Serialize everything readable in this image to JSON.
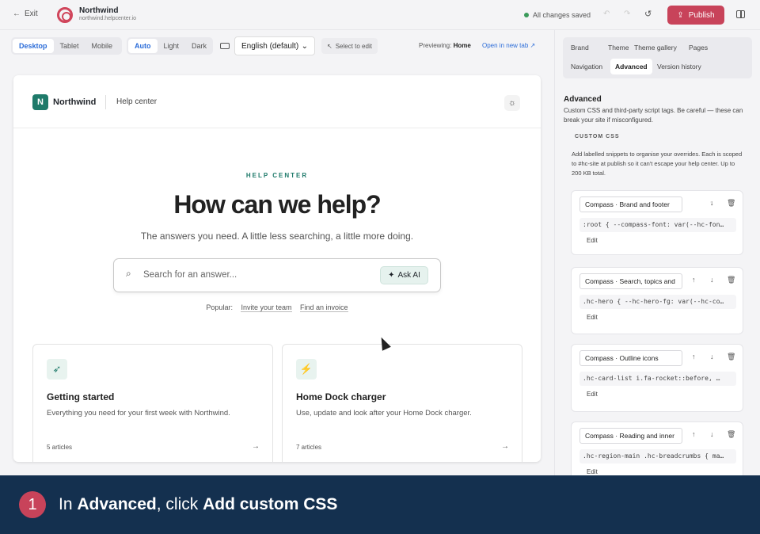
{
  "topbar": {
    "exit_label": "Exit",
    "site_name": "Northwind",
    "site_url": "northwind.helpcenter.io",
    "save_status": "All changes saved",
    "publish_label": "Publish"
  },
  "toolbar": {
    "devices": [
      "Desktop",
      "Tablet",
      "Mobile"
    ],
    "active_device": "Desktop",
    "themes": [
      "Auto",
      "Light",
      "Dark"
    ],
    "active_theme": "Auto",
    "language": "English (default)",
    "select_to_edit": "Select to edit",
    "previewing_label": "Previewing:",
    "previewing_page": "Home",
    "open_new_tab": "Open in new tab"
  },
  "site": {
    "logo_letter": "N",
    "name": "Northwind",
    "section": "Help center",
    "eyebrow": "HELP CENTER",
    "hero": "How can we help?",
    "subtitle": "The answers you need. A little less searching, a little more doing.",
    "search_placeholder": "Search for an answer...",
    "ask_ai": "Ask AI",
    "popular_label": "Popular:",
    "popular_links": [
      "Invite your team",
      "Find an invoice"
    ],
    "cards": [
      {
        "title": "Getting started",
        "desc": "Everything you need for your first week with Northwind.",
        "count": "5 articles",
        "icon": "rocket-icon"
      },
      {
        "title": "Home Dock charger",
        "desc": "Use, update and look after your Home Dock charger.",
        "count": "7 articles",
        "icon": "charger-icon"
      }
    ]
  },
  "panel": {
    "tabs_row1": [
      "Brand",
      "Theme",
      "Theme gallery",
      "Pages"
    ],
    "tabs_row2": [
      "Navigation",
      "Advanced",
      "Version history"
    ],
    "active_tab": "Advanced",
    "title": "Advanced",
    "desc": "Custom CSS and third-party script tags. Be careful — these can break your site if misconfigured.",
    "section_label": "CUSTOM CSS",
    "section_desc": "Add labelled snippets to organise your overrides. Each is scoped to #hc-site at publish so it can't escape your help center. Up to 200 KB total.",
    "edit_label": "Edit",
    "snippets": [
      {
        "name": "Compass · Brand and footer",
        "code": ":root { --compass-font: var(--hc-fon…"
      },
      {
        "name": "Compass · Search, topics and",
        "code": ".hc-hero { --hc-hero-fg: var(--hc-co…"
      },
      {
        "name": "Compass · Outline icons",
        "code": ".hc-card-list i.fa-rocket::before, …"
      },
      {
        "name": "Compass · Reading and inner",
        "code": ".hc-region-main .hc-breadcrumbs { ma…"
      }
    ]
  },
  "caption": {
    "step": "1",
    "text_pre": "In ",
    "text_b1": "Advanced",
    "text_mid": ", click ",
    "text_b2": "Add custom CSS"
  },
  "colors": {
    "accent": "#c8435a",
    "brand": "#1e7a6a",
    "link": "#2b6cd8",
    "caption_bg": "#14304f"
  }
}
